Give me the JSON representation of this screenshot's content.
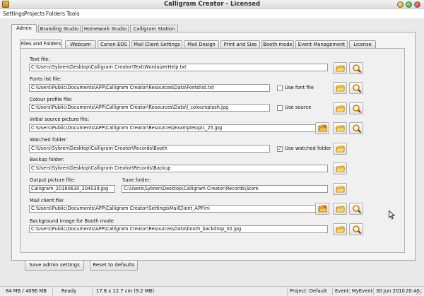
{
  "window": {
    "title": "Calligram Creator - Licensed"
  },
  "menu": [
    "Settings",
    "Projects",
    "Folders",
    "Tools"
  ],
  "main_tabs": [
    "Admin",
    "Branding Studio",
    "Homework Studio",
    "Calligram Station"
  ],
  "sub_tabs": [
    "Files and Folders",
    "Webcam",
    "Canon EOS",
    "Mail Client Settings",
    "Mail Design",
    "Print and Size",
    "Booth mode",
    "Event Management",
    "License"
  ],
  "files": {
    "text_file": {
      "label": "Text file:",
      "value": "C:\\Users\\Sybren\\Desktop\\Calligram Creator\\Text\\WordaizerHelp.txt"
    },
    "fonts_list": {
      "label": "Fonts list file:",
      "value": "C:\\Users\\Public\\Documents\\APP\\Calligram Creator\\Resources\\Data\\Fontslist.txt",
      "checkbox_label": "Use font file",
      "checked": false
    },
    "colour_profile": {
      "label": "Colour profile file:",
      "value": "C:\\Users\\Public\\Documents\\APP\\Calligram Creator\\Resources\\Data\\l_coloursplash.jpg",
      "checkbox_label": "Use source",
      "checked": false
    },
    "initial_source": {
      "label": "Initial source picture file:",
      "value": "C:\\Users\\Public\\Documents\\APP\\Calligram Creator\\Resources\\Examples\\pic_25.jpg"
    },
    "watched_folder": {
      "label": "Watched folder:",
      "value": "C:\\Users\\Sybren\\Desktop\\Calligram Creator\\Records\\Booth",
      "checkbox_label": "Use watched folder",
      "checked": true
    },
    "backup_folder": {
      "label": "Backup folder:",
      "value": "C:\\Users\\Sybren\\Desktop\\Calligram Creator\\Records\\Backup"
    },
    "output_picture": {
      "label": "Output picture file:",
      "value": "Calligram_20180630_204039.jpg"
    },
    "save_folder": {
      "label": "Save folder:",
      "value": "C:\\Users\\Sybren\\Desktop\\Calligram Creator\\Records\\Store"
    },
    "mail_client": {
      "label": "Mail client file:",
      "value": "C:\\Users\\Public\\Documents\\APP\\Calligram Creator\\Settings\\MailClient_APP.ini"
    },
    "background_image": {
      "label": "Background image for Booth mode",
      "value": "C:\\Users\\Public\\Documents\\APP\\Calligram Creator\\Resources\\Data\\booth_backdrop_02.jpg"
    }
  },
  "buttons": {
    "save_admin": "Save admin settings",
    "reset": "Reset to defaults"
  },
  "status": {
    "memory": "84 MB / 4096 MB",
    "state": "Ready",
    "size": "17.8 x 12.7 cm  (9.2 MB)",
    "project": "Project: Default",
    "event": "Event: MyEvent",
    "date": "30 Jun 2018",
    "time": "20:40"
  },
  "colors": {
    "folder_icon": "#f0c23c",
    "search_icon_lens": "#d07a10",
    "accent_check": "#2a64c8"
  }
}
